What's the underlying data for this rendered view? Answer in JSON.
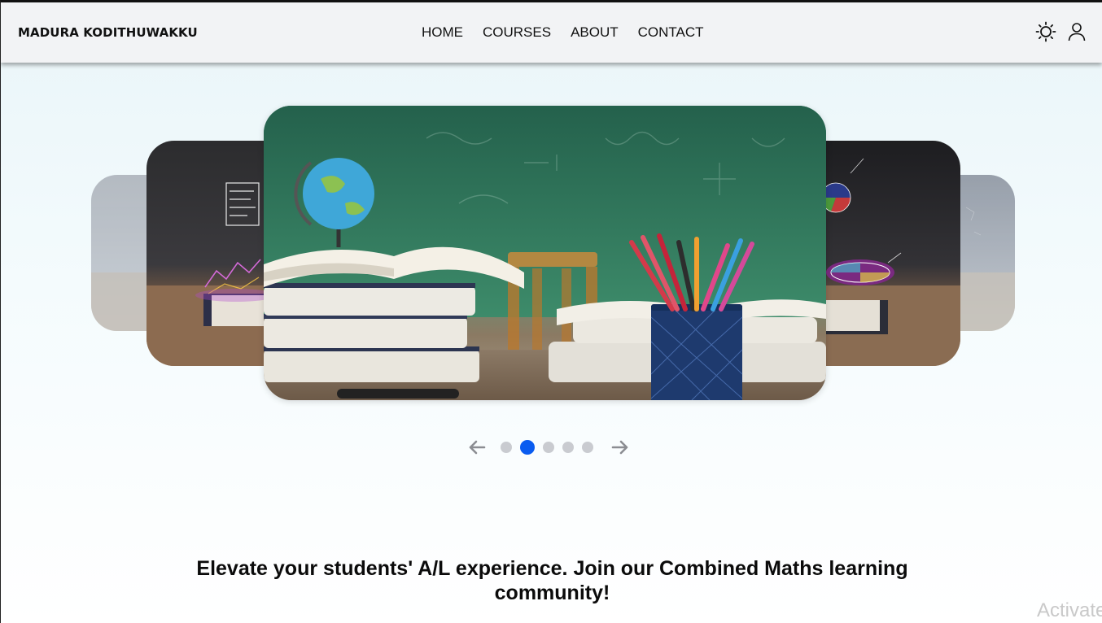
{
  "header": {
    "brand": "MADURA KODITHUWAKKU",
    "nav": [
      {
        "label": "HOME"
      },
      {
        "label": "COURSES"
      },
      {
        "label": "ABOUT"
      },
      {
        "label": "CONTACT"
      }
    ],
    "icons": [
      "sun-icon",
      "user-icon"
    ]
  },
  "carousel": {
    "slide_count": 5,
    "active_index": 1,
    "prev_icon": "arrow-left-icon",
    "next_icon": "arrow-right-icon",
    "active_color": "#0a5cf0",
    "inactive_color": "#c9cbd0"
  },
  "hero": {
    "tagline": "Elevate your students' A/L experience. Join our Combined Maths learning community!"
  },
  "watermark": "Activate"
}
